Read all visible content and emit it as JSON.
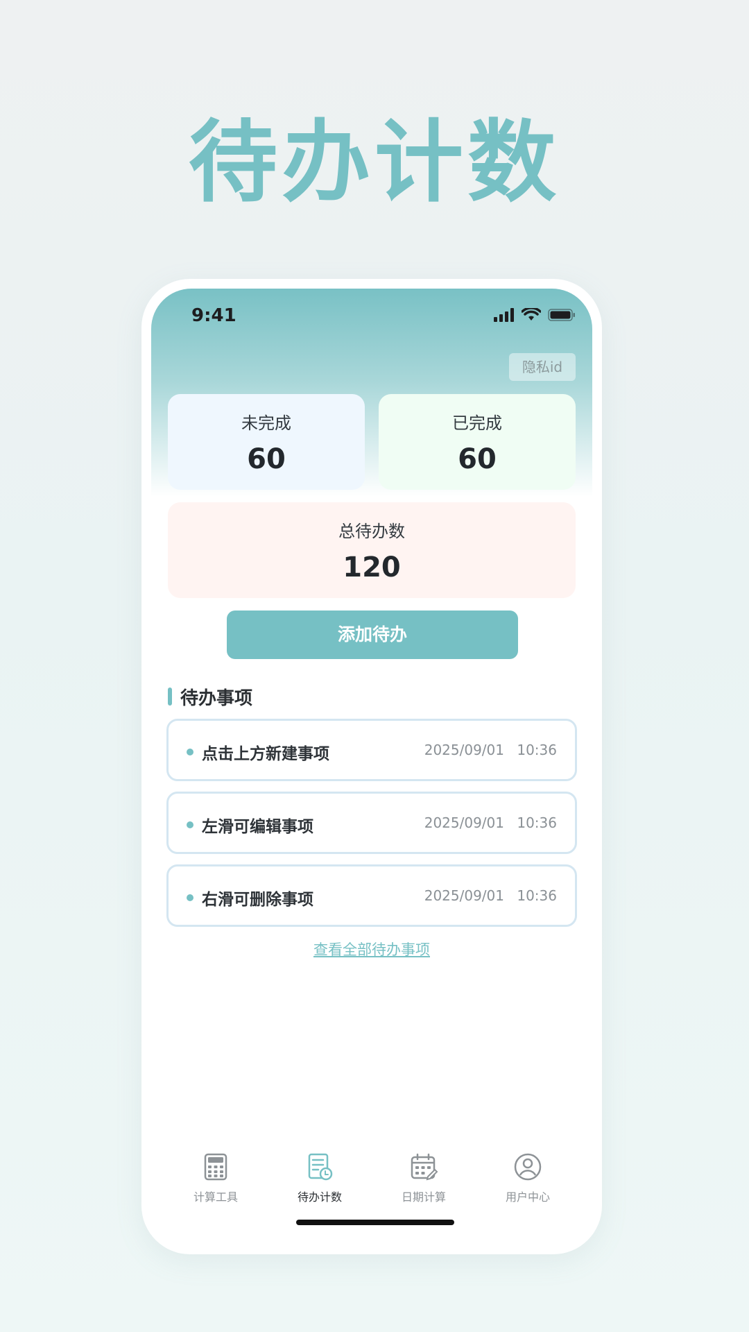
{
  "hero": {
    "title": "待办计数"
  },
  "status_bar": {
    "time": "9:41"
  },
  "privacy": {
    "label": "隐私id"
  },
  "stats": {
    "incomplete": {
      "label": "未完成",
      "value": "60"
    },
    "complete": {
      "label": "已完成",
      "value": "60"
    },
    "total": {
      "label": "总待办数",
      "value": "120"
    }
  },
  "add_button": {
    "label": "添加待办"
  },
  "section": {
    "title": "待办事项"
  },
  "todos": [
    {
      "title": "点击上方新建事项",
      "date": "2025/09/01",
      "time": "10:36"
    },
    {
      "title": "左滑可编辑事项",
      "date": "2025/09/01",
      "time": "10:36"
    },
    {
      "title": "右滑可删除事项",
      "date": "2025/09/01",
      "time": "10:36"
    }
  ],
  "view_all": {
    "label": "查看全部待办事项"
  },
  "tabbar": {
    "items": [
      {
        "label": "计算工具",
        "icon": "calculator-icon",
        "active": false
      },
      {
        "label": "待办计数",
        "icon": "todo-list-icon",
        "active": true
      },
      {
        "label": "日期计算",
        "icon": "calendar-icon",
        "active": false
      },
      {
        "label": "用户中心",
        "icon": "user-icon",
        "active": false
      }
    ]
  },
  "colors": {
    "accent": "#76c0c4",
    "incomplete_bg": "#eff7fe",
    "complete_bg": "#f0fdf4",
    "total_bg": "#fff4f2"
  }
}
